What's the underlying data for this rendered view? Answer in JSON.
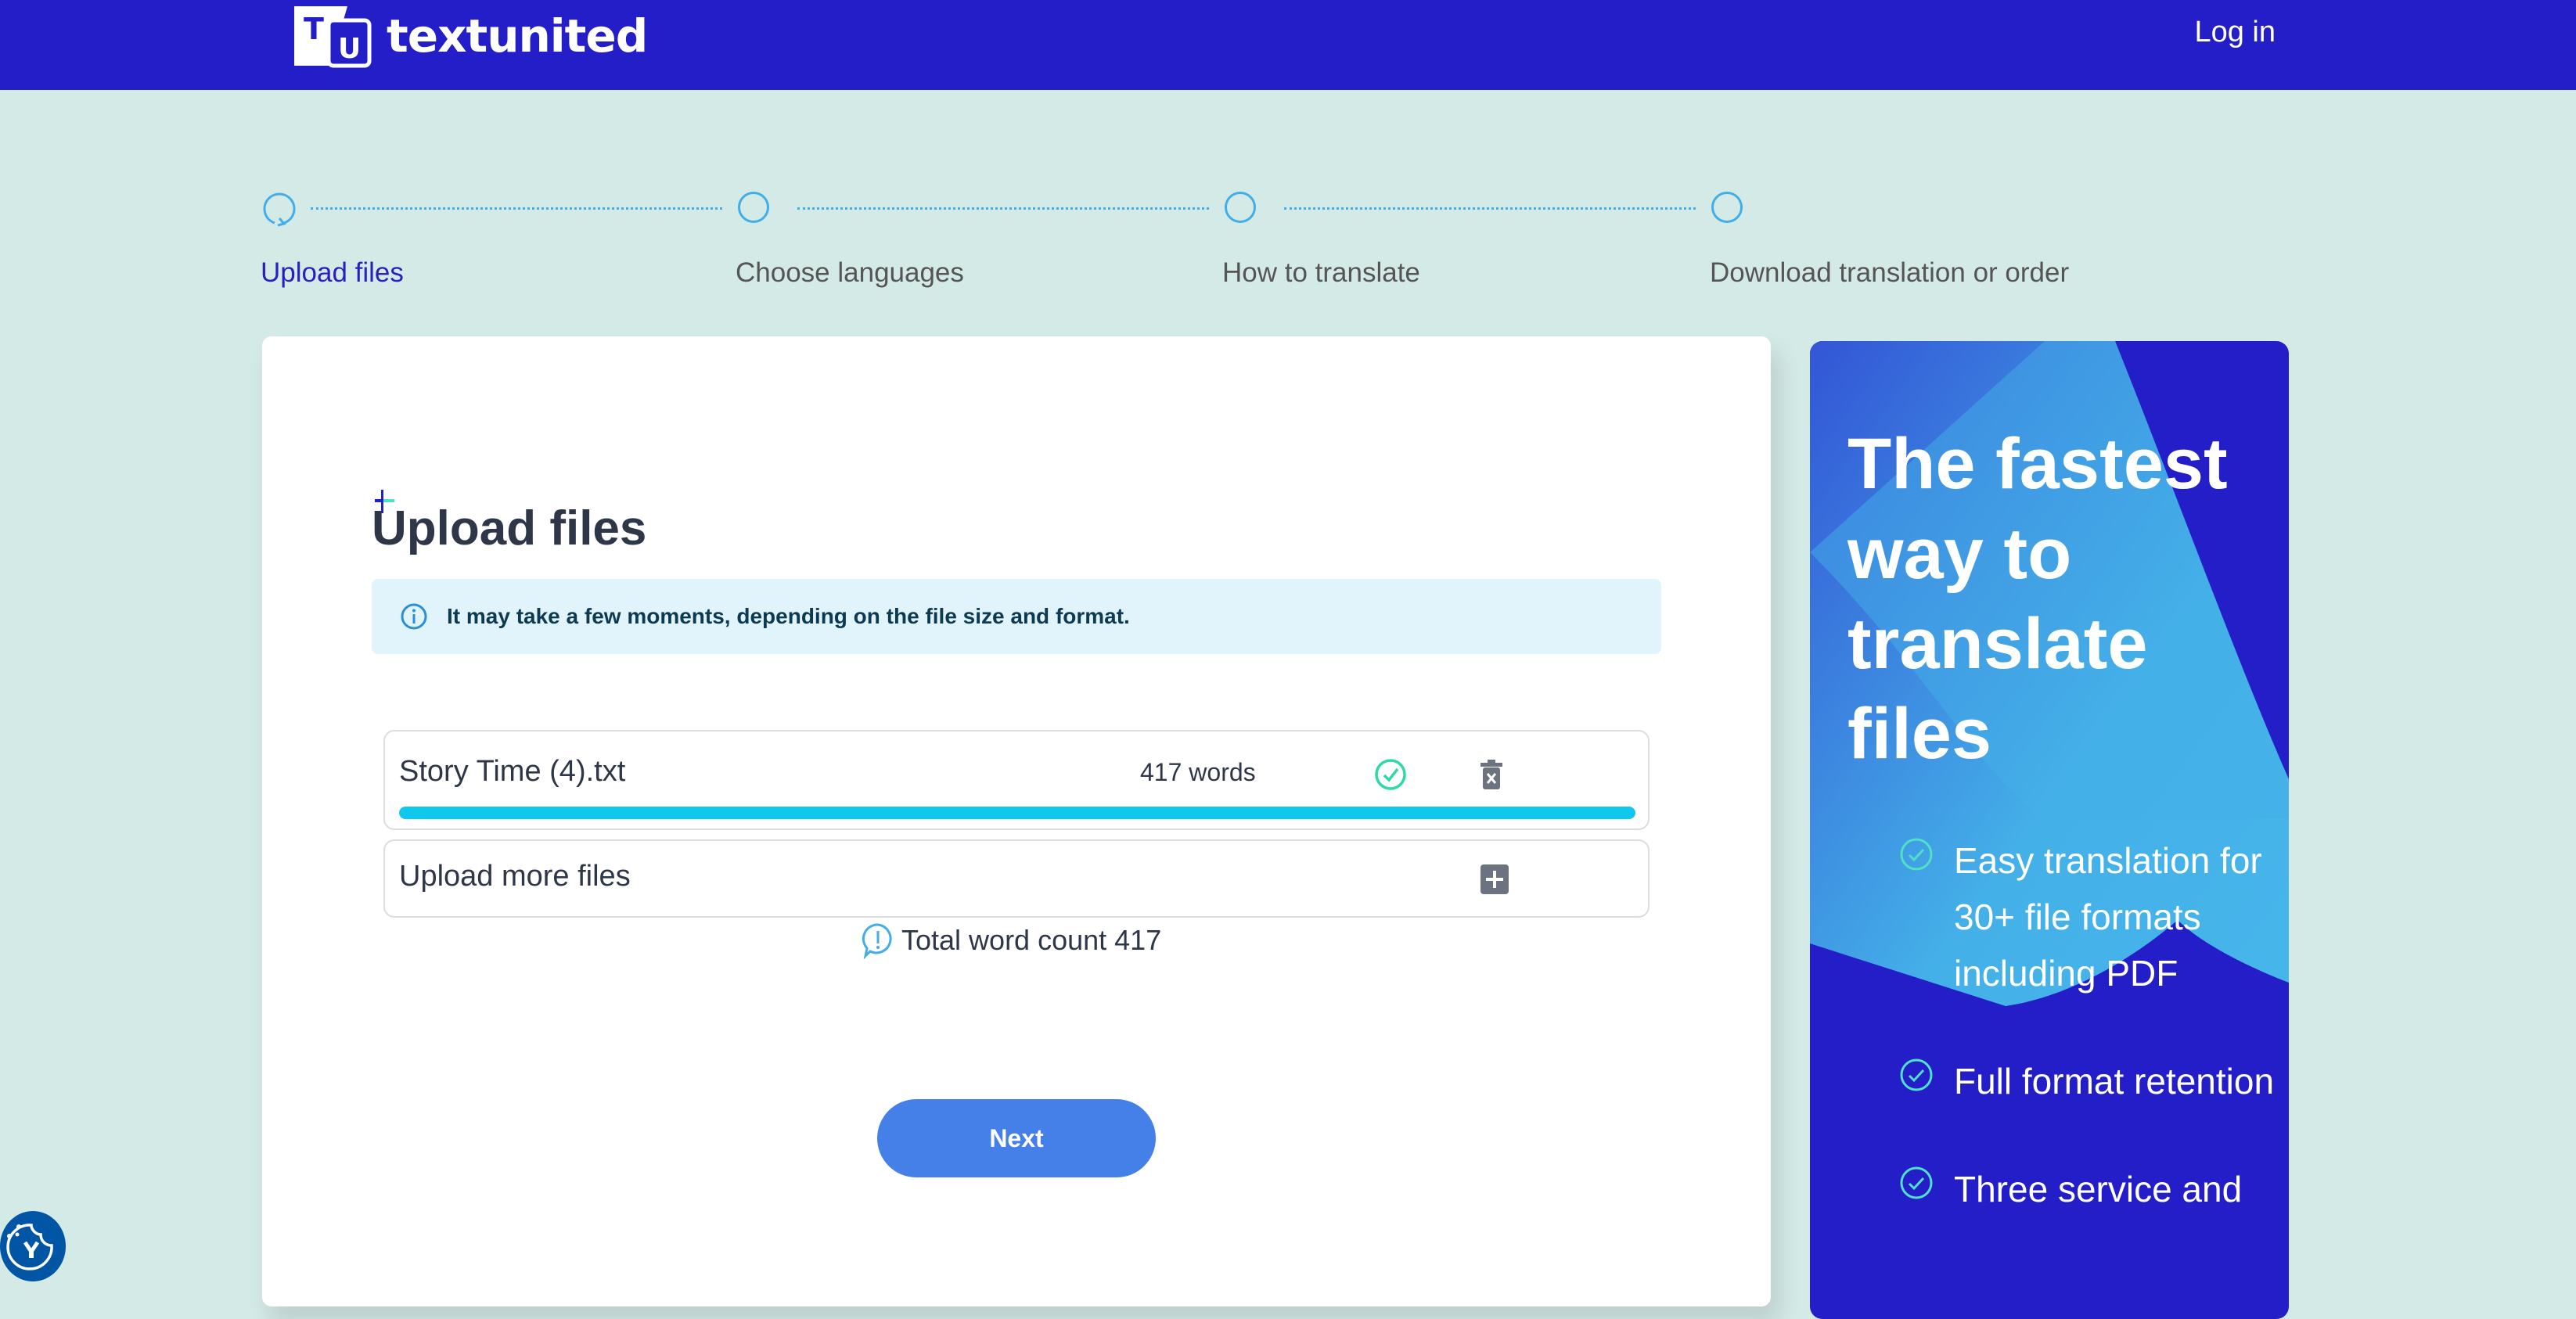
{
  "header": {
    "logo_text": "textunited",
    "logo_mark": "TU",
    "login_label": "Log in"
  },
  "stepper": {
    "steps": [
      {
        "label": "Upload files",
        "state": "active"
      },
      {
        "label": "Choose languages",
        "state": "pending"
      },
      {
        "label": "How to translate",
        "state": "pending"
      },
      {
        "label": "Download translation or order",
        "state": "pending"
      }
    ]
  },
  "upload": {
    "title": "Upload files",
    "notice": "It may take a few moments, depending on the file size and format.",
    "files": [
      {
        "name": "Story Time (4).txt",
        "words": "417 words",
        "status": "complete",
        "progress": 1.0
      }
    ],
    "upload_more_label": "Upload more files",
    "total_label": "Total word count 417",
    "next_label": "Next"
  },
  "promo": {
    "title": "The fastest way to translate files",
    "features": [
      "Easy translation for 30+ file formats including PDF",
      "Full format retention",
      "Three service and"
    ]
  },
  "colors": {
    "brand": "#241ec9",
    "accent": "#457fe8",
    "progress": "#10c8ee",
    "success": "#2ed8a7",
    "background": "#d4eae7"
  }
}
